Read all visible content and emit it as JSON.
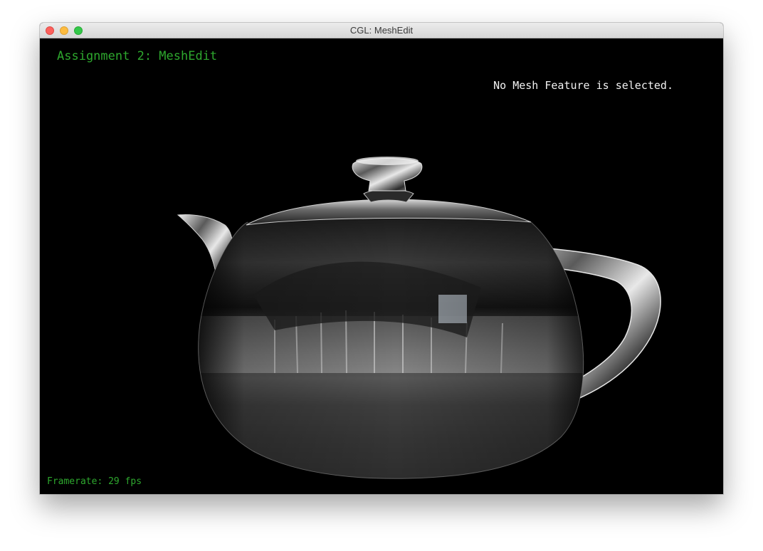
{
  "window": {
    "title": "CGL: MeshEdit"
  },
  "hud": {
    "title": "Assignment 2: MeshEdit",
    "status": "No Mesh Feature is selected.",
    "framerate": "Framerate: 29 fps"
  },
  "colors": {
    "hud_green": "#2ea82e",
    "status_white": "#f2f2f2",
    "viewport_bg": "#000000"
  },
  "scene": {
    "model": "teapot",
    "material": "chrome-environment-map"
  }
}
